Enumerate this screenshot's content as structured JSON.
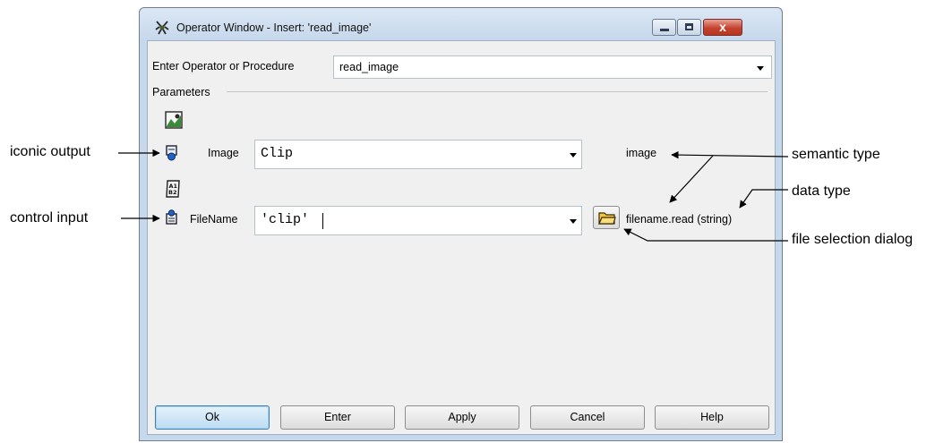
{
  "window": {
    "title": "Operator Window - Insert: 'read_image'",
    "close_glyph": "x",
    "close_color": "#c4422f"
  },
  "operator": {
    "label": "Enter Operator or Procedure",
    "value": "read_image"
  },
  "parameters": {
    "group_label": "Parameters",
    "rows": [
      {
        "name": "Image",
        "value": "Clip",
        "type_text": "image"
      },
      {
        "name": "FileName",
        "value": "'clip'",
        "type_text": "filename.read (string)"
      }
    ]
  },
  "buttons": {
    "ok": "Ok",
    "enter": "Enter",
    "apply": "Apply",
    "cancel": "Cancel",
    "help": "Help"
  },
  "annotations": {
    "iconic_output": "iconic output",
    "control_input": "control input",
    "semantic_type": "semantic type",
    "data_type": "data type",
    "file_selection_dialog": "file selection dialog"
  },
  "icons": {
    "app": "halcon-insect-icon",
    "iconic_group": "iconic-image-icon",
    "control_group": "control-a1b2-icon",
    "image_param": "iconic-output-param-icon",
    "file_param": "control-input-param-icon",
    "folder": "folder-icon"
  }
}
